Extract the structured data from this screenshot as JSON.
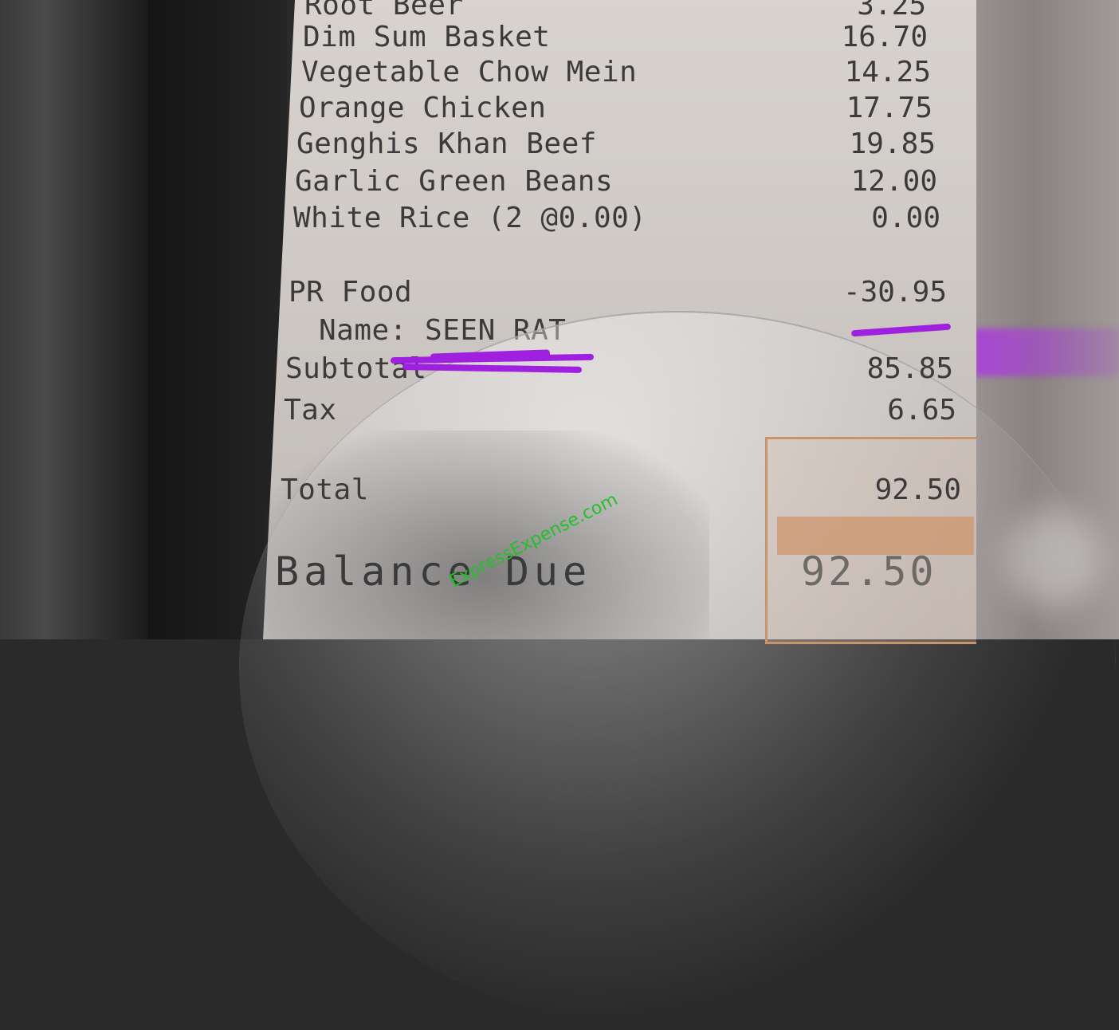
{
  "receipt": {
    "items": [
      {
        "name": "Root Beer",
        "price": "3.25"
      },
      {
        "name": "Dim Sum Basket",
        "price": "16.70"
      },
      {
        "name": "Vegetable Chow Mein",
        "price": "14.25"
      },
      {
        "name": "Orange Chicken",
        "price": "17.75"
      },
      {
        "name": "Genghis Khan Beef",
        "price": "19.85"
      },
      {
        "name": "Garlic Green Beans",
        "price": "12.00"
      },
      {
        "name": "White Rice (2 @0.00)",
        "price": "0.00"
      }
    ],
    "discount": {
      "label": "PR Food",
      "amount": "-30.95"
    },
    "name_line": "Name: SEEN RAT",
    "subtotal": {
      "label": "Subtotal",
      "amount": "85.85"
    },
    "tax": {
      "label": "Tax",
      "amount": "6.65"
    },
    "total": {
      "label": "Total",
      "amount": "92.50"
    },
    "balance_due": {
      "label": "Balance Due",
      "amount": "92.50"
    }
  },
  "watermark": "ExpressExpense.com",
  "colors": {
    "scribble": "#a020e0",
    "watermark": "#22c02a",
    "paper": "#d8d3cf"
  }
}
